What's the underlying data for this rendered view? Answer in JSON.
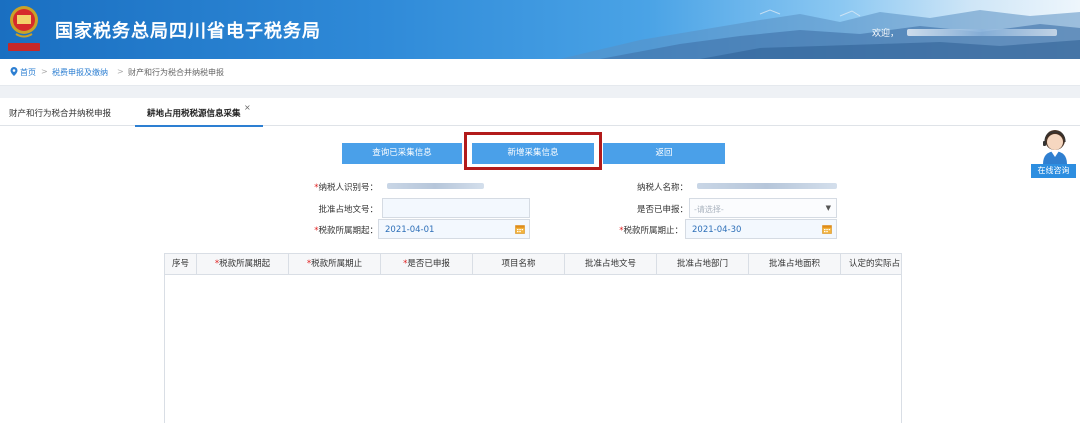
{
  "header": {
    "title": "国家税务总局四川省电子税务局",
    "welcome": "欢迎，"
  },
  "breadcrumb": {
    "items": [
      "首页",
      "税费申报及缴纳",
      "财产和行为税合并纳税申报"
    ],
    "separator": ">"
  },
  "tabs": [
    {
      "label": "财产和行为税合并纳税申报"
    },
    {
      "label": "耕地占用税税源信息采集"
    }
  ],
  "tab_close": "×",
  "buttons": {
    "query": "查询已采集信息",
    "add": "新增采集信息",
    "back": "返回"
  },
  "form": {
    "taxpayer_id_label": "纳税人识别号：",
    "taxpayer_name_label": "纳税人名称：",
    "approval_doc_label": "批准占地文号：",
    "declared_label": "是否已申报：",
    "declared_placeholder": "-请选择-",
    "period_start_label": "税款所属期起：",
    "period_start_value": "2021-04-01",
    "period_end_label": "税款所属期止：",
    "period_end_value": "2021-04-30",
    "required_mark": "*"
  },
  "table": {
    "columns": [
      {
        "label": "序号",
        "required": false
      },
      {
        "label": "税款所属期起",
        "required": true
      },
      {
        "label": "税款所属期止",
        "required": true
      },
      {
        "label": "是否已申报",
        "required": true
      },
      {
        "label": "项目名称",
        "required": false
      },
      {
        "label": "批准占地文号",
        "required": false
      },
      {
        "label": "批准占地部门",
        "required": false
      },
      {
        "label": "批准占地面积",
        "required": false
      },
      {
        "label": "认定的实际占",
        "required": false
      }
    ]
  },
  "side_widget": {
    "label": "在线咨询"
  },
  "colors": {
    "accent": "#4aa0e9",
    "highlight_border": "#b21b1b",
    "required": "#e02020",
    "link": "#2d7fd2"
  }
}
